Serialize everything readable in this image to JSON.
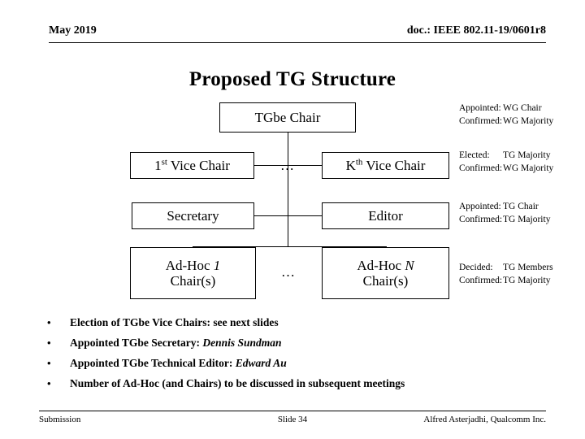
{
  "header": {
    "date": "May 2019",
    "doc": "doc.: IEEE 802.11-19/0601r8"
  },
  "title": "Proposed TG Structure",
  "diagram": {
    "nodes": {
      "chair": "TGbe Chair",
      "vice_chair_first_num": "1",
      "vice_chair_first_sup": "st",
      "vice_chair_first_rest": " Vice Chair",
      "vice_chair_k_num": "K",
      "vice_chair_k_sup": "th",
      "vice_chair_k_rest": " Vice Chair",
      "secretary": "Secretary",
      "editor": "Editor",
      "adhoc_first_prefix": "Ad-Hoc ",
      "adhoc_first_index": "1",
      "adhoc_first_line2": "Chair(s)",
      "adhoc_n_prefix": "Ad-Hoc ",
      "adhoc_n_index": "N",
      "adhoc_n_line2": "Chair(s)"
    },
    "ellipsis_vice_chairs": "…",
    "ellipsis_adhoc": "…"
  },
  "annotations": {
    "chair": {
      "row1_label": "Appointed:",
      "row1_value": "WG Chair",
      "row2_label": "Confirmed:",
      "row2_value": "WG Majority"
    },
    "vice_chairs": {
      "row1_label": "Elected:",
      "row1_value": "TG Majority",
      "row2_label": "Confirmed:",
      "row2_value": "WG Majority"
    },
    "secretary_editor": {
      "row1_label": "Appointed:",
      "row1_value": "TG Chair",
      "row2_label": "Confirmed:",
      "row2_value": "TG Majority"
    },
    "adhoc": {
      "row1_label": "Decided:",
      "row1_value": "TG Members",
      "row2_label": "Confirmed:",
      "row2_value": "TG Majority"
    }
  },
  "bullets": [
    {
      "marker": "•",
      "text": "Election of TGbe Vice Chairs: see next slides",
      "emphasis": ""
    },
    {
      "marker": "•",
      "text": "Appointed TGbe Secretary: ",
      "emphasis": "Dennis Sundman"
    },
    {
      "marker": "•",
      "text": "Appointed TGbe Technical Editor: ",
      "emphasis": "Edward Au"
    },
    {
      "marker": "•",
      "text": "Number of Ad-Hoc (and Chairs) to be discussed in subsequent meetings",
      "emphasis": ""
    }
  ],
  "footer": {
    "left": "Submission",
    "center": "Slide 34",
    "right": "Alfred Asterjadhi, Qualcomm Inc."
  }
}
